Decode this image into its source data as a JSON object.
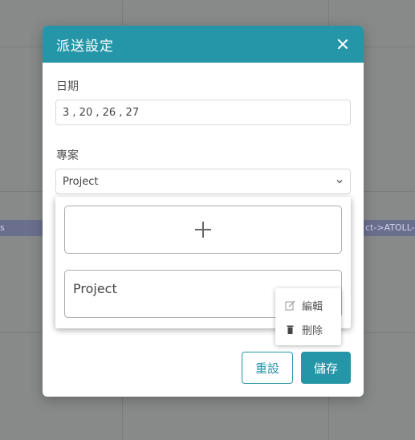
{
  "background": {
    "event_left": "s",
    "event_right": "ct->ATOLL-"
  },
  "modal": {
    "title": "派送設定",
    "date_label": "日期",
    "date_value": "3 , 20 , 26 , 27",
    "project_label": "專案",
    "project_selected": "Project",
    "dropdown": {
      "project_card_label": "Project"
    },
    "context_menu": {
      "edit_label": "編輯",
      "delete_label": "刪除"
    },
    "reset_label": "重設",
    "save_label": "儲存"
  },
  "colors": {
    "accent": "#2595a8",
    "overlay": "#888a8a"
  },
  "icons": [
    "close-icon",
    "chevron-down-icon",
    "plus-icon",
    "edit-icon",
    "trash-icon"
  ]
}
